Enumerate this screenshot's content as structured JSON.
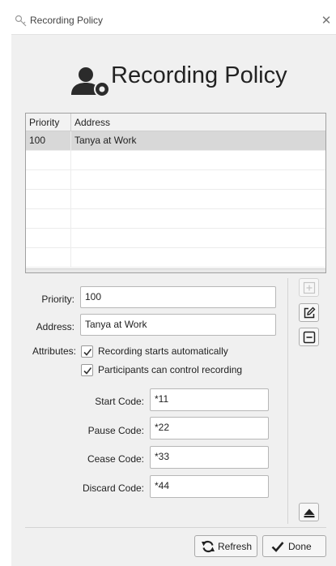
{
  "window": {
    "title": "Recording Policy",
    "close_glyph": "✕"
  },
  "header": {
    "title": "Recording Policy",
    "icon": "user-recording-icon"
  },
  "table": {
    "columns": [
      "Priority",
      "Address"
    ],
    "rows": [
      {
        "priority": "100",
        "address": "Tanya at Work",
        "selected": true
      },
      {
        "priority": "",
        "address": ""
      },
      {
        "priority": "",
        "address": ""
      },
      {
        "priority": "",
        "address": ""
      },
      {
        "priority": "",
        "address": ""
      },
      {
        "priority": "",
        "address": ""
      },
      {
        "priority": "",
        "address": ""
      }
    ]
  },
  "form": {
    "priority_label": "Priority:",
    "priority_value": "100",
    "address_label": "Address:",
    "address_value": "Tanya at Work",
    "attributes_label": "Attributes:",
    "attr_auto_label": "Recording starts automatically",
    "attr_auto_checked": true,
    "attr_control_label": "Participants can control recording",
    "attr_control_checked": true,
    "start_code_label": "Start Code:",
    "start_code_value": "*11",
    "pause_code_label": "Pause Code:",
    "pause_code_value": "*22",
    "cease_code_label": "Cease Code:",
    "cease_code_value": "*33",
    "discard_code_label": "Discard Code:",
    "discard_code_value": "*44"
  },
  "side_buttons": [
    {
      "name": "add-button",
      "icon": "plus-box-icon",
      "enabled": false
    },
    {
      "name": "edit-button",
      "icon": "edit-icon",
      "enabled": true
    },
    {
      "name": "remove-button",
      "icon": "minus-box-icon",
      "enabled": true
    },
    {
      "name": "clear-button",
      "icon": "eraser-icon",
      "enabled": true
    }
  ],
  "footer": {
    "refresh_label": "Refresh",
    "done_label": "Done"
  },
  "colors": {
    "window_bg": "#f0f0f0",
    "selection": "#d8d8d8",
    "border": "#a0a0a0"
  }
}
